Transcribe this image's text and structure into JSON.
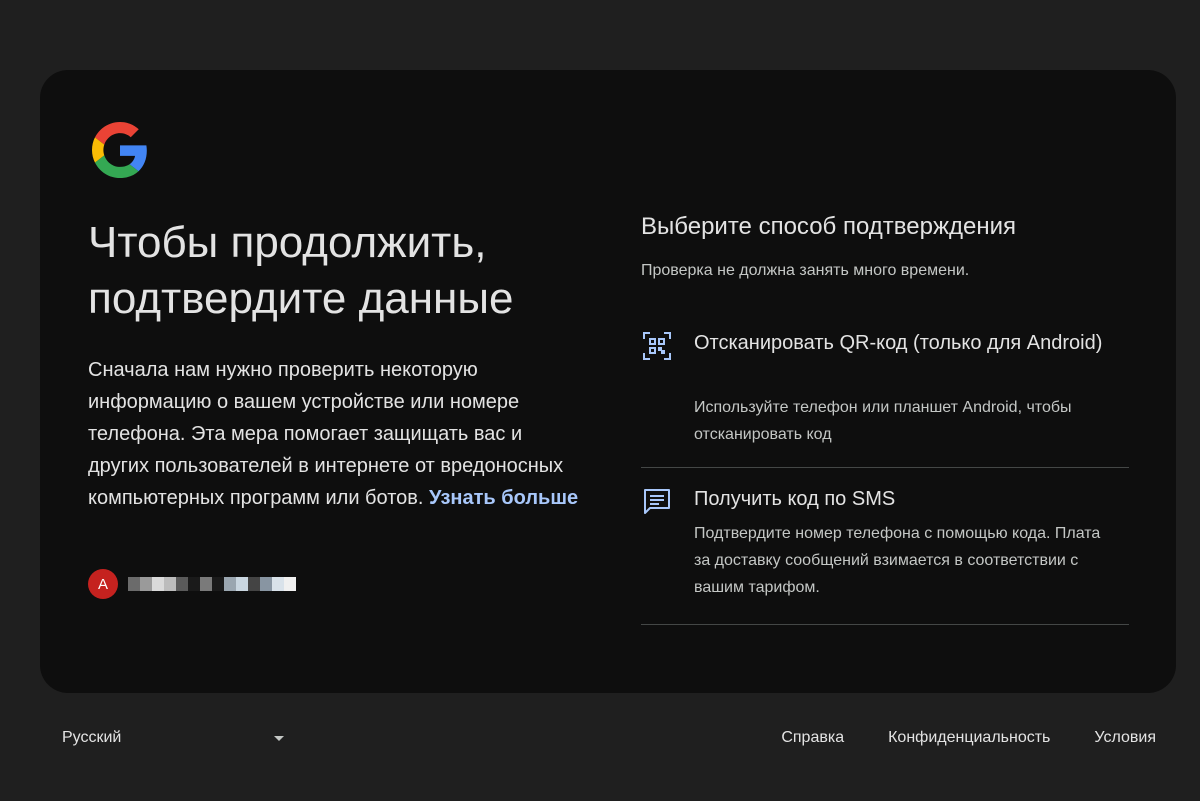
{
  "left": {
    "logo_icon": "google-g-logo",
    "headline_line1": "Чтобы продолжить,",
    "headline_line2": "подтвердите данные",
    "intro_text": "Сначала нам нужно проверить некоторую информацию о вашем устройстве или номере телефона. Эта мера помогает защищать вас и других пользователей в интернете от вредоносных компьютерных программ или ботов.",
    "learn_more": "Узнать больше",
    "account": {
      "avatar_letter": "A"
    }
  },
  "right": {
    "title": "Выберите способ подтверждения",
    "subtitle": "Проверка не должна занять много времени.",
    "options": [
      {
        "icon": "qr-code-scan-icon",
        "title": "Отсканировать QR-код (только для Android)",
        "description": "Используйте телефон или планшет Android, чтобы отсканировать код"
      },
      {
        "icon": "sms-message-icon",
        "title": "Получить код по SMS",
        "description": "Подтвердите номер телефона с помощью кода. Плата за доставку сообщений взимается в соответствии с вашим тарифом."
      }
    ]
  },
  "footer": {
    "language": "Русский",
    "links": [
      "Справка",
      "Конфиденциальность",
      "Условия"
    ]
  },
  "colors": {
    "background": "#1f1f1f",
    "card": "#0e0e0e",
    "link": "#a8c7fa",
    "avatar": "#c5221f",
    "divider": "#444746"
  }
}
